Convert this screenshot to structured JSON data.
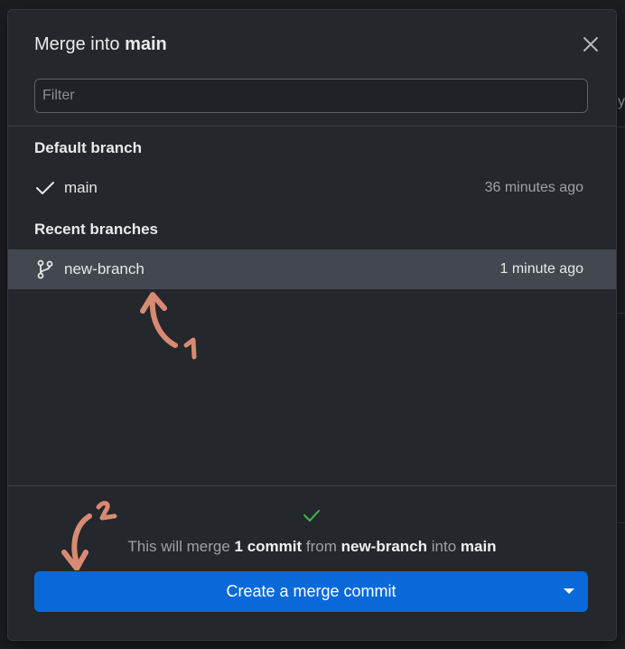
{
  "dialog": {
    "title_prefix": "Merge into ",
    "title_branch": "main",
    "close_icon": "close-icon"
  },
  "filter": {
    "placeholder": "Filter",
    "value": ""
  },
  "default_section": {
    "heading": "Default branch",
    "branch": {
      "name": "main",
      "time": "36 minutes ago",
      "icon": "check-icon"
    }
  },
  "recent_section": {
    "heading": "Recent branches",
    "branch": {
      "name": "new-branch",
      "time": "1 minute ago",
      "icon": "git-branch-icon",
      "selected": true
    }
  },
  "annotations": {
    "label_1": "1",
    "label_2": "2",
    "color": "#d98a72"
  },
  "footer": {
    "status_icon": "check-icon",
    "msg_prefix": "This will merge ",
    "msg_commits": "1 commit",
    "msg_from": " from ",
    "msg_source": "new-branch",
    "msg_into": " into ",
    "msg_target": "main",
    "button_label": "Create a merge commit",
    "button_color": "#0a69d8"
  },
  "background": {
    "partial_text": "y"
  }
}
